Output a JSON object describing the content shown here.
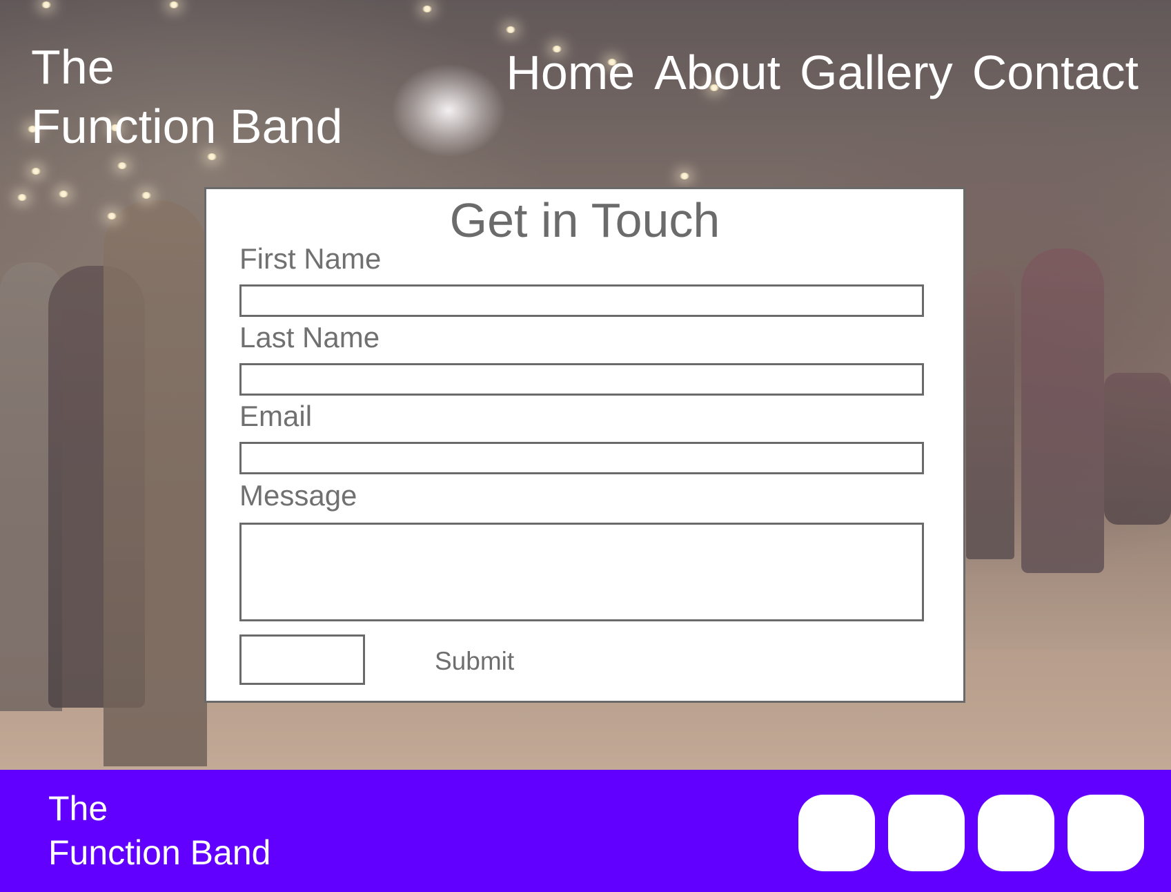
{
  "header": {
    "brand_line1": "The",
    "brand_line2": "Function Band",
    "nav": [
      "Home",
      "About",
      "Gallery",
      "Contact"
    ]
  },
  "form": {
    "title": "Get in Touch",
    "fields": [
      {
        "label": "First Name",
        "value": ""
      },
      {
        "label": "Last Name",
        "value": ""
      },
      {
        "label": "Email",
        "value": ""
      },
      {
        "label": "Message",
        "value": ""
      }
    ],
    "submit_label": "Submit"
  },
  "footer": {
    "brand_line1": "The",
    "brand_line2": "Function Band",
    "social_icons": [
      "social-icon-1",
      "social-icon-2",
      "social-icon-3",
      "social-icon-4"
    ],
    "background_color": "#6200ff"
  }
}
